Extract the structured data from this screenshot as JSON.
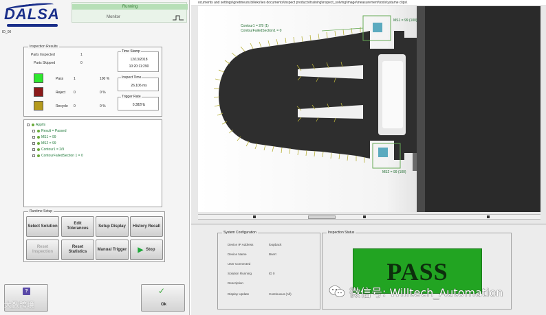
{
  "app": {
    "logo": "DALSA",
    "id": "ID_00"
  },
  "mode": {
    "running": "Running",
    "monitor": "Monitor"
  },
  "inspection_results": {
    "title": "Inspection Results",
    "parts_inspected_label": "Parts Inspected",
    "parts_inspected_value": "1",
    "parts_skipped_label": "Parts Skipped",
    "parts_skipped_value": "0",
    "pass": {
      "label": "Pass",
      "count": "1",
      "pct": "100 %",
      "color": "#2ee82e"
    },
    "reject": {
      "label": "Reject",
      "count": "0",
      "pct": "0 %",
      "color": "#8b1a1a"
    },
    "recycle": {
      "label": "Recycle",
      "count": "0",
      "pct": "0 %",
      "color": "#b59a1c"
    },
    "time_stamp_label": "Time Stamp",
    "time_stamp_date": "12/13/2018",
    "time_stamp_time": "10:20:11:290",
    "inspect_time_label": "Inspect Time",
    "inspect_time_value": "26.106 ms",
    "trigger_rate_label": "Trigger Rate",
    "trigger_rate_value": "0.382Hz"
  },
  "tree": {
    "items": [
      "App/Is",
      "Result = Passed",
      "MS1 = 99",
      "MS2 = 99",
      "Contour1 = 2/9",
      "ContourFailedSection 1 = 0"
    ]
  },
  "runtime_setup": {
    "title": "Runtime Setup",
    "buttons": {
      "select_solution": "Select Solution",
      "edit_tolerances": "Edit Tolerances",
      "setup_display": "Setup Display",
      "history_recall": "History Recall",
      "reset_inspection": "Reset Inspection",
      "reset_statistics": "Reset Statistics",
      "manual_trigger": "Manual Trigger",
      "stop": "Stop"
    }
  },
  "footer": {
    "ok": "Ok",
    "watermark_left": "大数跨境"
  },
  "image_view": {
    "path": "ocuments and settings\\gnetmeurs.billeks\\ies documents\\inspect products\\training\\inspect_solving\\image\\measurement\\tools\\ystame clips\\",
    "label_contour": "Contour1 = 2/9 (1)",
    "label_contour_fail": "ContourFailedSection1 = 0",
    "label_ms1": "MS1 = 99 (100)",
    "label_ms2": "MS2 = 99 (100)"
  },
  "system_configuration": {
    "title": "System Configuration",
    "rows": [
      {
        "label": "Device IP Address",
        "value": "loopback"
      },
      {
        "label": "Device Name",
        "value": "Bsert"
      },
      {
        "label": "User Connected",
        "value": ""
      },
      {
        "label": "Solution Running",
        "value": "ID 0"
      },
      {
        "label": "Description",
        "value": ""
      },
      {
        "label": "Display Update",
        "value": "Continuous (All)"
      }
    ]
  },
  "inspection_status": {
    "title": "Inspection Status",
    "status": "PASS",
    "color": "#22a422"
  },
  "wechat": {
    "text": "微信号: Willtech_Automation"
  }
}
